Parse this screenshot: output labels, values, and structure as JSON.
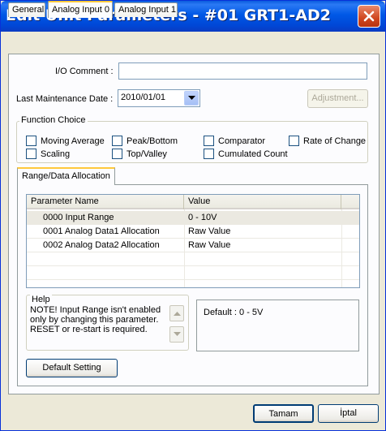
{
  "window": {
    "title": "Edit Unit Parameters - #01 GRT1-AD2",
    "close_glyph": "✕"
  },
  "tabs": [
    {
      "label": "General"
    },
    {
      "label": "Analog Input 0",
      "active": true
    },
    {
      "label": "Analog Input 1"
    }
  ],
  "form": {
    "io_comment_label": "I/O Comment :",
    "io_comment_value": "",
    "maintenance_label": "Last Maintenance Date :",
    "maintenance_value": "2010/01/01",
    "adjustment_label": "Adjustment..."
  },
  "function_choice": {
    "title": "Function Choice",
    "options": [
      {
        "label": "Moving Average",
        "checked": false
      },
      {
        "label": "Peak/Bottom",
        "checked": false
      },
      {
        "label": "Comparator",
        "checked": false
      },
      {
        "label": "Rate of Change",
        "checked": false
      },
      {
        "label": "Scaling",
        "checked": false
      },
      {
        "label": "Top/Valley",
        "checked": false
      },
      {
        "label": "Cumulated Count",
        "checked": false
      }
    ]
  },
  "range_tab": {
    "label": "Range/Data Allocation"
  },
  "table": {
    "columns": [
      "Parameter Name",
      "Value"
    ],
    "rows": [
      {
        "name": "0000 Input Range",
        "value": "0 - 10V"
      },
      {
        "name": "0001 Analog Data1 Allocation",
        "value": "Raw Value"
      },
      {
        "name": "0002 Analog Data2 Allocation",
        "value": "Raw Value"
      }
    ]
  },
  "help": {
    "title": "Help",
    "text": "NOTE! Input Range isn't enabled only by changing this parameter. RESET or re-start is required."
  },
  "default_text": "Default : 0 - 5V",
  "buttons": {
    "default_setting": "Default Setting",
    "ok": "Tamam",
    "cancel": "İptal"
  },
  "colors": {
    "title_bar": "#0058e6",
    "close_button": "#d0461f",
    "window_bg": "#ece9d8",
    "tab_highlight": "#ffc83c"
  }
}
